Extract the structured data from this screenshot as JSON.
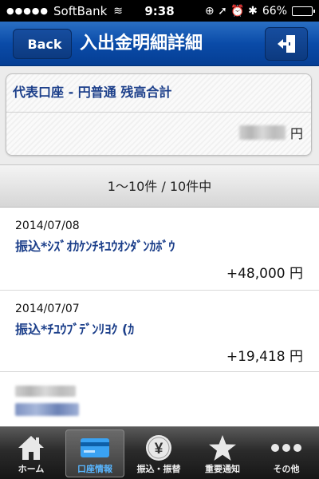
{
  "status": {
    "signal": "●●●●●",
    "carrier": "SoftBank",
    "wifi": "≋",
    "time": "9:38",
    "icons": "⊕ ➚ ⏰ ✱",
    "battery_pct": "66%",
    "battery_level": 0.66
  },
  "nav": {
    "back_label": "Back",
    "title": "入出金明細詳細",
    "logout_icon": "logout-door-icon"
  },
  "account": {
    "name": "代表口座 - 円普通 残高合計",
    "currency": "円"
  },
  "pagination": {
    "label": "1〜10件 / 10件中"
  },
  "transactions": [
    {
      "date": "2014/07/08",
      "description": "振込*ｼｽﾞｵｶｹﾝﾁｷﾕｳｵﾝﾀﾞﾝｶﾎﾞｳ",
      "amount": "+48,000 円"
    },
    {
      "date": "2014/07/07",
      "description": "振込*ﾁﾕｳﾌﾞﾃﾞﾝﾘﾖｸ (ｶ",
      "amount": "+19,418 円"
    }
  ],
  "tabs": [
    {
      "label": "ホーム",
      "icon": "home-icon"
    },
    {
      "label": "口座情報",
      "icon": "card-icon",
      "active": true
    },
    {
      "label": "振込・振替",
      "icon": "yen-coin-icon",
      "glyph": "¥"
    },
    {
      "label": "重要通知",
      "icon": "star-icon"
    },
    {
      "label": "その他",
      "icon": "more-icon"
    }
  ],
  "colors": {
    "nav_blue": "#0a4ba8",
    "link_blue": "#1c3f8a",
    "active_tab": "#58b6ff"
  }
}
